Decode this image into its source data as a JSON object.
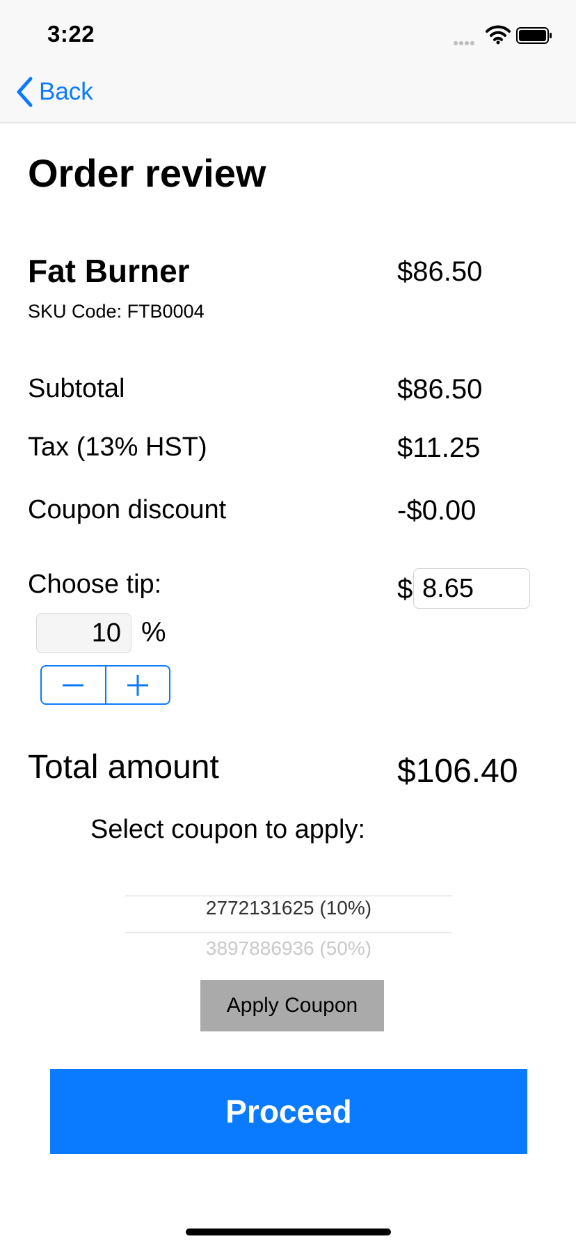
{
  "status_bar": {
    "time": "3:22"
  },
  "nav": {
    "back_label": "Back"
  },
  "page_title": "Order review",
  "product": {
    "name": "Fat Burner",
    "sku": "SKU Code: FTB0004",
    "price": "$86.50"
  },
  "summary": {
    "subtotal_label": "Subtotal",
    "subtotal_value": "$86.50",
    "tax_label": "Tax (13% HST)",
    "tax_value": "$11.25",
    "coupon_label": "Coupon discount",
    "coupon_value": "-$0.00"
  },
  "tip": {
    "label": "Choose tip:",
    "currency_symbol": "$",
    "amount": "8.65",
    "percent": "10",
    "percent_sign": "%"
  },
  "total": {
    "label": "Total amount",
    "value": "$106.40"
  },
  "coupon": {
    "prompt": "Select coupon to apply:",
    "options": [
      "2772131625  (10%)",
      "3897886936  (50%)"
    ],
    "selected_index": 0,
    "apply_label": "Apply Coupon"
  },
  "proceed_label": "Proceed",
  "colors": {
    "accent": "#0a7aff",
    "apply_button": "#aaaaaa",
    "nav_background": "#f8f8f8"
  }
}
